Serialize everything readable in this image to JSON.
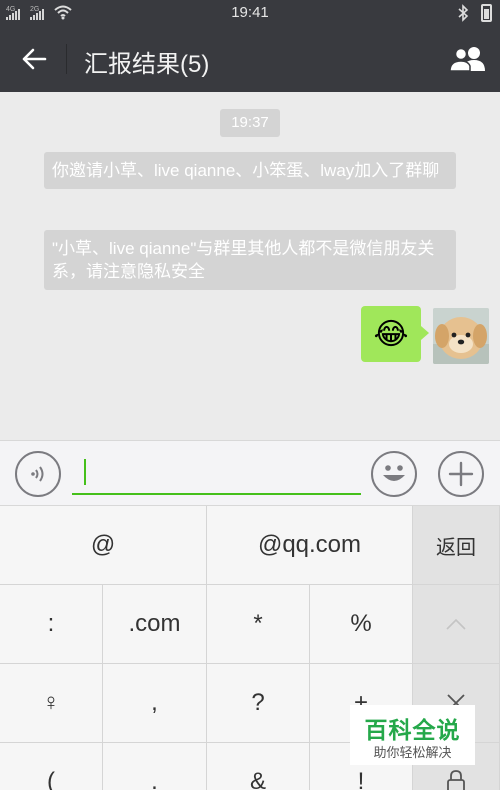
{
  "status_bar": {
    "signal1": "4G",
    "signal2": "2G",
    "time": "19:41"
  },
  "header": {
    "title": "汇报结果(5)",
    "back_icon": "back-arrow-icon",
    "group_icon": "group-members-icon"
  },
  "chat": {
    "timestamp": "19:37",
    "system_messages": [
      "你邀请小草、live qianne、小笨蛋、lway加入了群聊",
      "\"小草、live qianne\"与群里其他人都不是微信朋友关系，请注意隐私安全"
    ],
    "sent_message": "😂"
  },
  "input_bar": {
    "voice_icon": "voice-icon",
    "emoji_icon": "emoji-icon",
    "plus_icon": "plus-icon",
    "value": "",
    "accent_color": "#45c01a"
  },
  "keyboard": {
    "row1": [
      "@",
      "@qq.com",
      "返回"
    ],
    "row2": [
      ":",
      ".com",
      "*",
      "%",
      "^"
    ],
    "row3": [
      "♀",
      ",",
      "?",
      "+",
      "×"
    ],
    "row4": [
      "(",
      ".",
      "&",
      "!"
    ],
    "lock_icon": "lock-icon"
  },
  "watermark": {
    "title": "百科全说",
    "subtitle": "助你轻松解决"
  }
}
